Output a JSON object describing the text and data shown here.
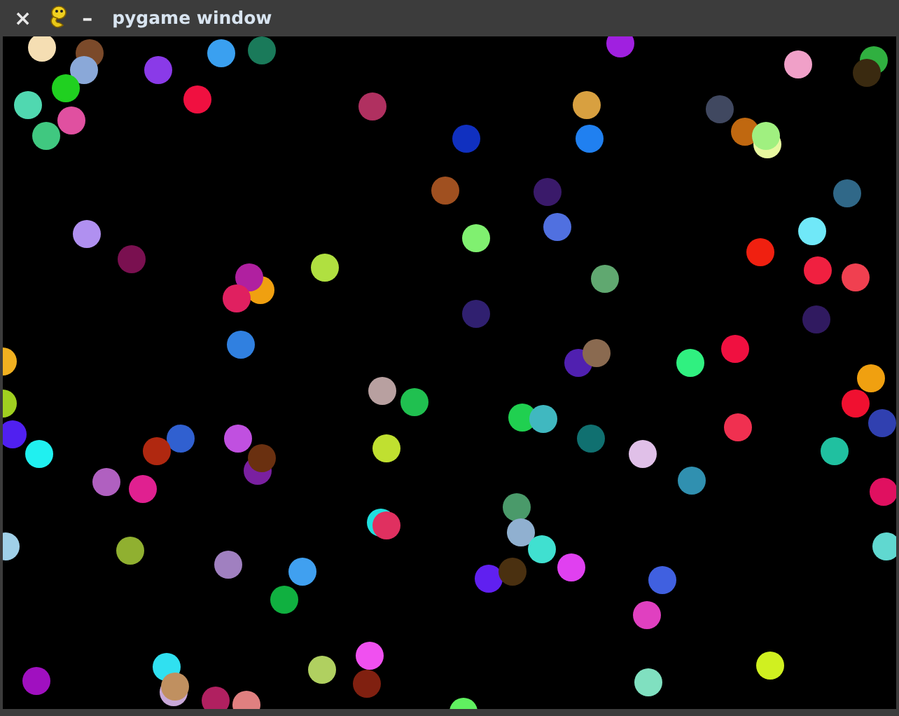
{
  "window": {
    "close_button": "×",
    "minimize_button": "–",
    "title": "pygame window"
  }
}
